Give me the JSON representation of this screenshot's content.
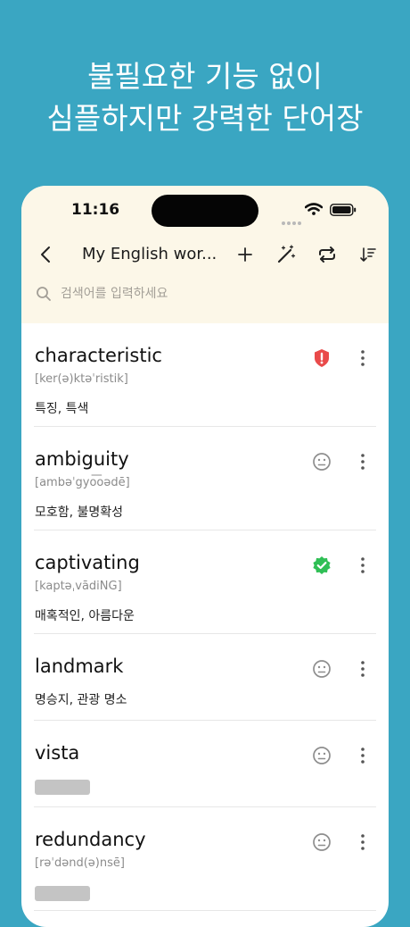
{
  "headline": {
    "line1": "불필요한 기능 없이",
    "line2": "심플하지만 강력한 단어장"
  },
  "status_bar": {
    "time": "11:16"
  },
  "toolbar": {
    "title": "My English wor..."
  },
  "search": {
    "placeholder": "검색어를 입력하세요"
  },
  "words": [
    {
      "word": "characteristic",
      "phonetic": "[ker(ə)ktəˈristik]",
      "meaning": "특징, 특색",
      "status": "warning-badge-icon",
      "status_color": "#e94a4a"
    },
    {
      "word": "ambiguity",
      "phonetic": "[ambəˈgyo͞oədē]",
      "meaning": "모호함, 불명확성",
      "status": "neutral-face-icon",
      "status_color": "#8e8e8e"
    },
    {
      "word": "captivating",
      "phonetic": "[kaptəˌvādiNG]",
      "meaning": "매혹적인, 아름다운",
      "status": "verified-check-icon",
      "status_color": "#2fbf55"
    },
    {
      "word": "landmark",
      "phonetic": "",
      "meaning": "명승지, 관광 명소",
      "status": "neutral-face-icon",
      "status_color": "#8e8e8e"
    },
    {
      "word": "vista",
      "phonetic": "",
      "meaning": "",
      "meaning_hidden": true,
      "status": "neutral-face-icon",
      "status_color": "#8e8e8e"
    },
    {
      "word": "redundancy",
      "phonetic": "[rəˈdənd(ə)nsē]",
      "meaning": "",
      "meaning_hidden": true,
      "status": "neutral-face-icon",
      "status_color": "#8e8e8e"
    }
  ]
}
